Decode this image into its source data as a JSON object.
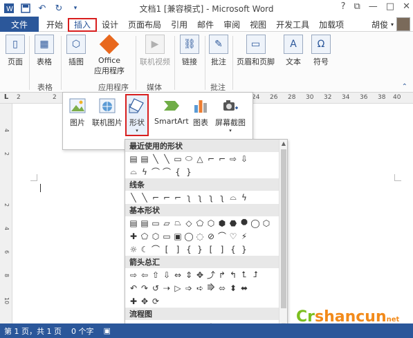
{
  "window": {
    "title": "文档1 [兼容模式] - Microsoft Word",
    "controls": [
      "?",
      "⧉",
      "—",
      "□",
      "✕"
    ]
  },
  "tabs": {
    "file": "文件",
    "items": [
      "开始",
      "插入",
      "设计",
      "页面布局",
      "引用",
      "邮件",
      "审阅",
      "视图",
      "开发工具",
      "加载项"
    ],
    "active_index": 1,
    "user": "胡俊"
  },
  "ribbon": {
    "page": "页面",
    "table": "表格",
    "illustrations": "插图",
    "office_apps_line1": "Office",
    "office_apps_line2": "应用程序",
    "online_video": "联机视频",
    "link": "链接",
    "comment": "批注",
    "header_footer": "页眉和页脚",
    "text": "文本",
    "symbol": "符号",
    "groups": {
      "table": "表格",
      "apps": "应用程序",
      "media": "媒体",
      "comments": "批注"
    }
  },
  "ruler_numbers": [
    "2",
    "2",
    "24",
    "26",
    "28",
    "30",
    "32",
    "34",
    "36",
    "38",
    "40"
  ],
  "vruler_numbers": [
    "4",
    "2",
    "2",
    "4",
    "6",
    "8",
    "10"
  ],
  "illus_menu": {
    "picture": "图片",
    "online_picture": "联机图片",
    "shapes": "形状",
    "smartart": "SmartArt",
    "chart": "图表",
    "screenshot": "屏幕截图"
  },
  "shapes_gallery": {
    "recent": "最近使用的形状",
    "lines": "线条",
    "basic": "基本形状",
    "arrows": "箭头总汇",
    "flowchart": "流程图",
    "recent_row1": [
      "▤",
      "▤",
      "╲",
      "╲",
      "▭",
      "⬭",
      "△",
      "⌐",
      "⌐",
      "⇨",
      "⇩"
    ],
    "recent_row2": [
      "⌓",
      "ϟ",
      "⌒",
      "⌒",
      "{",
      "}"
    ],
    "lines_row": [
      "╲",
      "╲",
      "⌐",
      "⌐",
      "⌐",
      "ʅ",
      "ʅ",
      "ʅ",
      "ʅ",
      "⌓",
      "ϟ"
    ],
    "basic_row1": [
      "▤",
      "▤",
      "▭",
      "▱",
      "⏢",
      "◇",
      "⬠",
      "⬡",
      "⬢",
      "⬣",
      "⯃",
      "◯",
      "⬡"
    ],
    "basic_row2": [
      "✚",
      "⬠",
      "⬡",
      "▭",
      "▣",
      "◯",
      "◌",
      "⊘",
      "⌒",
      "♡",
      "⚡"
    ],
    "basic_row3": [
      "☼",
      "☾",
      "⌒",
      "[",
      "]",
      "{",
      "}",
      "[",
      "]",
      "{",
      "}"
    ],
    "arrows_row1": [
      "⇨",
      "⇦",
      "⇧",
      "⇩",
      "⇔",
      "⇕",
      "✥",
      "⤴",
      "↱",
      "↰",
      "⮤",
      "⮥"
    ],
    "arrows_row2": [
      "↶",
      "↷",
      "↺",
      "⇢",
      "▷",
      "➩",
      "➪",
      "⭆",
      "⬄",
      "⬍",
      "⬌"
    ],
    "arrows_row3": [
      "✚",
      "✥",
      "⟳"
    ],
    "flow_row": [
      "▭",
      "▢",
      "◇",
      "▱",
      "▭",
      "▭",
      "▭",
      "◯",
      "▭",
      "⬭",
      "▽"
    ]
  },
  "status": {
    "page": "第 1 页，共 1 页",
    "words": "0 个字",
    "proof_icon": "proofing-icon"
  },
  "watermark": {
    "text_a": "Cr",
    "text_b": "shancun",
    "text_c": "net"
  }
}
